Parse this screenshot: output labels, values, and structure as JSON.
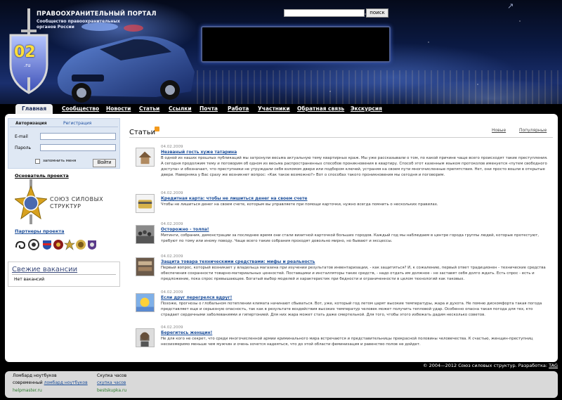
{
  "header": {
    "portal_title": "ПРАВООХРАНИТЕЛЬНЫЙ ПОРТАЛ",
    "portal_subtitle": "Сообщество правоохранительных органов России",
    "emblem_number": "02",
    "emblem_sub": ".ru",
    "search_placeholder": "",
    "search_button": "поиск"
  },
  "nav": {
    "items": [
      "Главная",
      "Сообщество",
      "Новости",
      "Статьи",
      "Ссылки",
      "Почта",
      "Работа",
      "Участники",
      "Обратная связь",
      "Экскурсия"
    ],
    "active": "Главная"
  },
  "auth": {
    "tab_login": "Авторизация",
    "tab_register": "Регистрация",
    "email_label": "E-mail",
    "password_label": "Пароль",
    "remember_label": "запомнить меня",
    "login_button": "Войти"
  },
  "sidebar": {
    "founder_title": "Основатель проекта",
    "union_name": "СОЮЗ СИЛОВЫХ СТРУКТУР",
    "partners_title": "Партнеры проекта",
    "vacancies_title": "Свежие вакансии",
    "vacancies_empty": "Нет вакансий"
  },
  "articles": {
    "heading": "Статьи",
    "filter_new": "Новые",
    "filter_popular": "Популярные",
    "items": [
      {
        "date": "04.02.2009",
        "title": "Незваный гость хуже татарина",
        "text": "В одной из наших прошлых публикаций мы затронули весьма актуальную тему квартирных краж. Мы уже рассказывали о том, по какой причине чаще всего происходят такие преступления. А сегодня продолжим тему и поговорим об одном из весьма распространенных способов проникновения в квартиру. Способ этот казенным языком протоколов именуется «путем свободного доступа» и обозначает, что преступники не утруждали себя взломом двери или подбором ключей, устраняя на своем пути многочисленные препятствия. Нет, они просто вошли в открытые двери. Наверняка у Вас сразу же возникнет вопрос: «Как такое возможно?» Вот о способах такого проникновения мы сегодня и поговорим."
      },
      {
        "date": "04.02.2009",
        "title": "Кредитная карта: чтобы не лишиться денег на своем счете",
        "text": "Чтобы не лишиться денег на своем счете, которым вы управляете при помощи карточки, нужно всегда помнить о нескольких правилах."
      },
      {
        "date": "04.02.2009",
        "title": "Осторожно - толпа!",
        "text": "Митинги, собрания, демонстрации за последнее время они стали визитной карточкой больших городов. Каждый год мы наблюдаем в центре города группы людей, которые протестуют, требуют по тому или иному поводу. Чаще всего такие собрания проходят довольно мирно, но бывают и эксцессы."
      },
      {
        "date": "04.02.2009",
        "title": "Защита товара техническими средствами: мифы и реальность",
        "text": "Первый вопрос, который возникает у владельца магазина при изучении результатов инвентаризации, - как защититься? И, к сожалению, первый ответ традиционен - технические средства обеспечения сохранности товарно-материальных ценностей. Поставщики и инсталляторы таких средств, - надо отдать им должное - не заставят себя долго ждать. Есть спрос - есть и предложение, пока спрос превышающее. Богатый выбор моделей и характеристик при бедности и ограниченности в целом технологий как таковых."
      },
      {
        "date": "04.02.2009",
        "title": "Если друг перегрелся вдруг!",
        "text": "Похоже, прогнозы о глобальном потеплении климата начинают сбываться. Вот, уже, который год летом царят высокие температуры, жара и духота. Не помню дискомфорта такая погода представляет еще и серьезную опасность, так как в результате воздействия высоких температур человек может получить тепловой удар. Особенно опасна такая погода для тех, кто страдает сердечными заболеваниями и гипертонией. Для них жара может стать даже смертельной. Для того, чтобы этого избежать дадим несколько советов."
      },
      {
        "date": "04.02.2009",
        "title": "Берегитесь женщин!",
        "text": "Не для кого не секрет, что среди многочисленной армии криминального мира встречаются и представительницы прекрасной половины человечества. К счастью, женщин-преступниц несоизмеримо меньше чем мужчин и очень хочется надеяться, что до этой области феминизация и равенство полов не дойдет."
      }
    ]
  },
  "footer": {
    "copyright_prefix": "© 2004—2012 Союз силовых структур. Разработка:",
    "copyright_dev": "TAG",
    "lombard_title": "Ломбард ноутбуков",
    "lombard_prefix": "современный",
    "lombard_link": "ломбард ноутбуков",
    "lombard_url": "helpmaster.ru",
    "skupka_title": "Скупка часов",
    "skupka_link": "скупка часов",
    "skupka_url": "bestskupka.ru"
  },
  "colors": {
    "link": "#1a4d9a",
    "header_dark": "#0b1a44",
    "panel": "#ffffff",
    "rss": "#f39a1d"
  }
}
